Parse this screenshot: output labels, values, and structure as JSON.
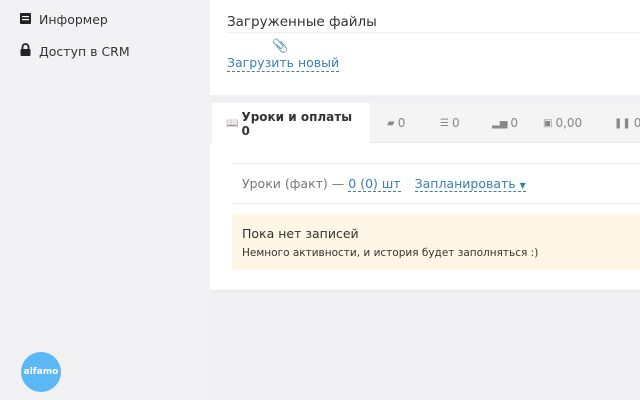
{
  "sidebar": {
    "items": [
      {
        "label": "Информер",
        "icon": "newspaper-icon"
      },
      {
        "label": "Доступ в CRM",
        "icon": "lock-icon"
      }
    ],
    "logo": "alfamo"
  },
  "files": {
    "title": "Загруженные файлы",
    "upload_label": "Загрузить новый"
  },
  "tabs": [
    {
      "label": "Уроки и оплаты 0",
      "icon": "book-icon"
    },
    {
      "label": "0",
      "icon": "comments-icon"
    },
    {
      "label": "0",
      "icon": "list-icon"
    },
    {
      "label": "0",
      "icon": "bar-chart-icon"
    },
    {
      "label": "0,00",
      "icon": "gift-icon"
    },
    {
      "label": "0",
      "icon": "pause-icon"
    }
  ],
  "lessons": {
    "label": "Уроки (факт) —",
    "count": "0 (0) шт",
    "plan_label": "Запланировать"
  },
  "notice": {
    "title": "Пока нет записей",
    "text": "Немного активности, и история будет заполняться :)"
  },
  "colors": {
    "accent": "#3a7fb0",
    "notice_bg": "#fff6e5",
    "logo": "#5bb8f5"
  }
}
